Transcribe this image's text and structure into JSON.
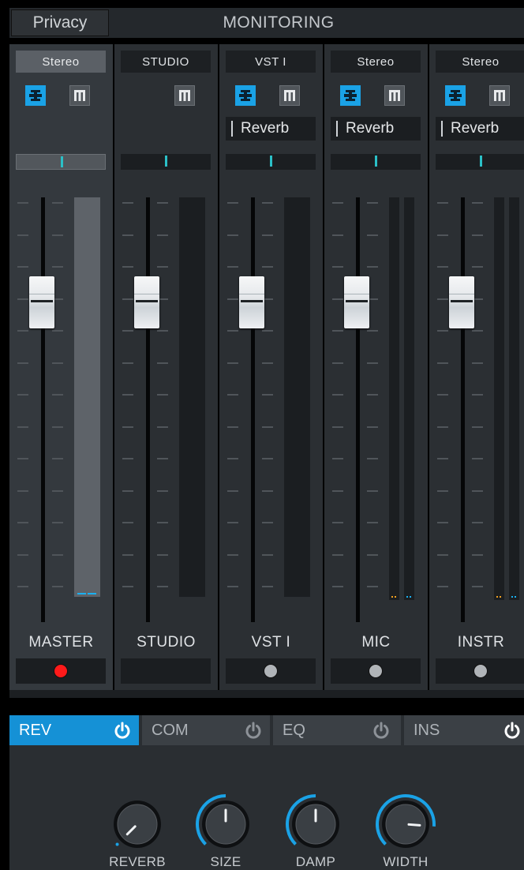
{
  "header": {
    "privacy_label": "Privacy",
    "title": "MONITORING"
  },
  "strips": [
    {
      "route": "Stereo",
      "name": "MASTER",
      "has_buttons": true,
      "insert": null,
      "pan": 0.5,
      "fader_db_label": "",
      "rec": "red",
      "master": true
    },
    {
      "route": "STUDIO",
      "name": "STUDIO",
      "has_buttons": "mon-only",
      "insert": null,
      "pan": 0.5,
      "rec": "none",
      "master": false
    },
    {
      "route": "VST I",
      "name": "VST I",
      "has_buttons": true,
      "insert": "Reverb",
      "pan": 0.5,
      "rec": "grey",
      "master": false
    },
    {
      "route": "Stereo",
      "name": "MIC",
      "has_buttons": true,
      "insert": "Reverb",
      "pan": 0.5,
      "rec": "grey",
      "master": false
    },
    {
      "route": "Stereo",
      "name": "INSTR",
      "has_buttons": true,
      "insert": "Reverb",
      "pan": 0.5,
      "rec": "grey",
      "master": false
    }
  ],
  "fx_tabs": [
    {
      "label": "REV",
      "active": true
    },
    {
      "label": "COM",
      "active": false
    },
    {
      "label": "EQ",
      "active": false
    },
    {
      "label": "INS",
      "active": false
    }
  ],
  "knobs": [
    {
      "label": "REVERB",
      "value": 0.0
    },
    {
      "label": "SIZE",
      "value": 0.5
    },
    {
      "label": "DAMP",
      "value": 0.5
    },
    {
      "label": "WIDTH",
      "value": 0.85
    }
  ],
  "colors": {
    "accent": "#1591d6",
    "link_button": "#1aa2e6",
    "pan_indicator": "#2bc0c7",
    "record_active": "#ff1a1a",
    "record_inactive": "#b0b4b8",
    "meter_peak_blue": "#1ab0f0",
    "meter_peak_orange": "#f0a020"
  },
  "icons": {
    "link": "link-icon",
    "monitor": "monitor-icon",
    "power": "power-icon"
  }
}
